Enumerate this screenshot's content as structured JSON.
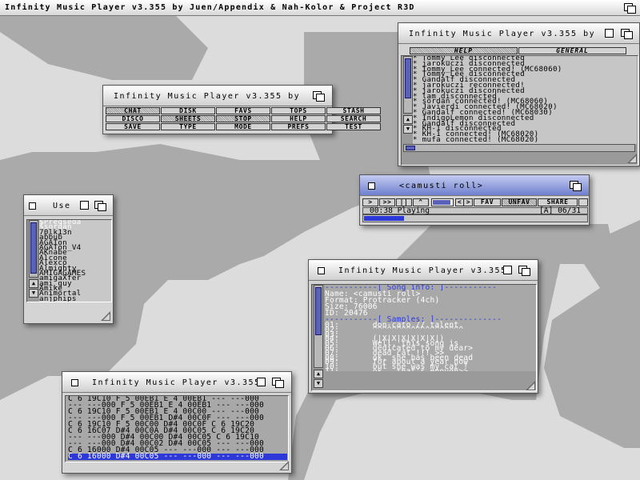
{
  "screen": {
    "title": "Infinity Music Player v3.355 by Juen/Appendix & Nah-Kolor & Project R3D"
  },
  "menu_window": {
    "title": "Infinity Music Player v3.355 by Ju",
    "buttons": [
      "CHAT",
      "DISK",
      "FAVS",
      "TOPS",
      "STASH",
      "DISCO",
      "SHEETS",
      "STOP",
      "HELP",
      "SEARCH",
      "SAVE",
      "TYPE",
      "MODE",
      "PREFS",
      "TEST"
    ],
    "selected": [
      0,
      6,
      7
    ]
  },
  "chat_window": {
    "title": "Infinity Music Player v3.355 by J",
    "tabs": [
      "HELP",
      "GENERAL"
    ],
    "log": [
      "* Tommy_Lee disconnected",
      "* jarokuczi disconnected",
      "* Tommy_Lee connected! (MC68060)",
      "* Tommy_Lee disconnected",
      "* Gandalf disconnected",
      "* jarokuczi reconnected!",
      "* jarokuczi disconnected",
      "* lam disconnected",
      "* sordan connected! (MC68060)",
      "* Javierdi connected! (MC68020)",
      "* Gandalf connected! (MC68030)",
      "* IndigoLemon disconnected",
      "* Gandalf disconnected",
      "* KH-1 disconnected",
      "* KH-1 connected! (MC68020)",
      "* mufa connected! (MC68020)"
    ]
  },
  "user_window": {
    "title": "Use",
    "users": [
      "$Predseda",
      "$sordan",
      "70lk13n",
      "abbub",
      "AGATon",
      "AGATon_V4",
      "AKnabe",
      "Alcone",
      "Alexco",
      "Almighty",
      "AMIGAGAMES",
      "amigaXfer",
      "ami_guy",
      "Amike",
      "Animortal",
      "anjphips"
    ],
    "highlighted": [
      0,
      1
    ]
  },
  "player_window": {
    "title": "<camusti roll>",
    "buttons": [
      ">",
      ">>",
      "||",
      "^",
      "<|>",
      "FAV",
      "UNFAV",
      "SHARE"
    ],
    "status_time": "00:38 Playing",
    "status_track": "[A] 06/31",
    "progress": 0.18,
    "colors": {
      "titlebar": "#6f7fcf",
      "progress": "#2d38d8"
    }
  },
  "info_window": {
    "title": "Infinity Music Player v3.355",
    "song_header": "-----------[ Song info: ]-----------",
    "song_info": [
      "Name: <camusti roll>",
      "Format: Protracker (4ch)",
      "Size: 76006",
      "ID: 20476"
    ],
    "samples_header": "-----------[ Samples: ]--------------",
    "samples": [
      "01:       don-cato // talent",
      "02:       ^^^^^^^^^^^^^^^^^^^",
      "03:",
      "04:       (|X|X|X|X|X|X|)",
      "05:       Well, this song is",
      "06:       dedicated to my dear>",
      "07:       dead cat !!! >>",
      "08:       ok, she has been dead",
      "09:       for about a year now",
      "10:       but she was my cat !",
      "11:       ok , that's enough>>",
      "12:       cat'bus talk!!!!!!"
    ]
  },
  "pattern_window": {
    "title": "Infinity Music Player v3.355",
    "rows": [
      "C 6 19C10 F 5 00EB1 E 4 00EB1 --- ---000",
      "--- ---000 F 5 00EB1 E 4 00EB1 --- ---000",
      "C 6 19C10 F 5 00EB1 E 4 00C00 --- ---000",
      "--- ---000 F 5 00EB1 D#4 00C0F --- ---000",
      "C 6 19C10 F 5 00C00 D#4 00C0F C 6 19C20",
      "C 6 16C07 D#4 00C0A D#4 00C05 C 6 19C20",
      "--- ---000 D#4 00C00 D#4 00C05 C 6 19C10",
      "--- ---000 D#4 00C02 D#4 00C05 --- ---000",
      "C 6 16000 D#4 00C05 --- ---000 --- ---000",
      "C 6 16000 D#4 00C05 --- ---000 --- ---000"
    ],
    "current_row": 9
  }
}
